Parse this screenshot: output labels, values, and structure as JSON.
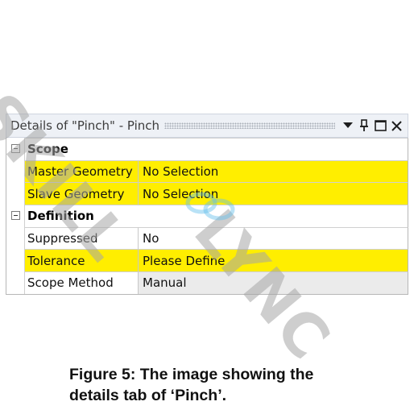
{
  "panel": {
    "title": "Details of \"Pinch\" - Pinch",
    "buttons": {
      "dropdown_icon": "triangle-down-icon",
      "pin_icon": "pin-icon",
      "maximize_icon": "square-icon",
      "close_icon": "close-icon"
    },
    "groups": [
      {
        "label": "Scope",
        "rows": [
          {
            "label": "Master Geometry",
            "value": "No Selection",
            "state": "undefined"
          },
          {
            "label": "Slave Geometry",
            "value": "No Selection",
            "state": "undefined"
          }
        ]
      },
      {
        "label": "Definition",
        "rows": [
          {
            "label": "Suppressed",
            "value": "No",
            "state": "normal"
          },
          {
            "label": "Tolerance",
            "value": "Please Define",
            "state": "undefined"
          },
          {
            "label": "Scope Method",
            "value": "Manual",
            "state": "readonly"
          }
        ]
      }
    ]
  },
  "colors": {
    "undefined_field": "#ffee00",
    "readonly_field": "#ebebeb",
    "titlebar": "#eef1f6"
  },
  "watermark": {
    "part1": "SKILL",
    "part2": "LYNC"
  },
  "caption": {
    "line1": "Figure 5:  The image showing the",
    "line2": "details tab of  ‘Pinch’."
  }
}
